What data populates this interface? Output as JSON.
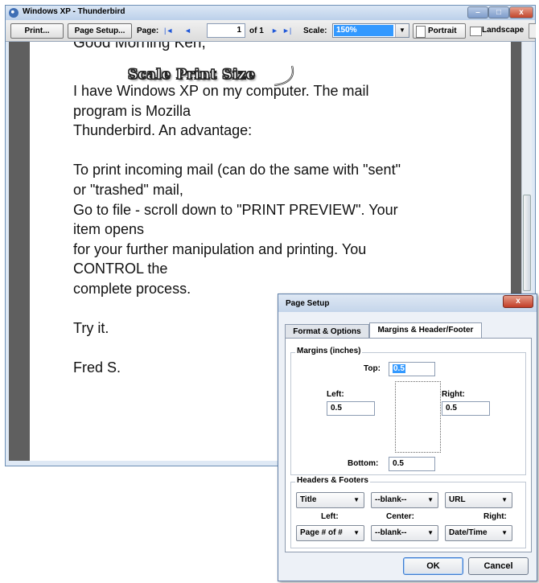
{
  "window": {
    "title": "Windows XP - Thunderbird",
    "controls": {
      "minimize": "–",
      "maximize": "□",
      "close": "x"
    }
  },
  "toolbar": {
    "print_label": "Print...",
    "page_setup_label": "Page Setup...",
    "page_label": "Page:",
    "first_page": "|◄",
    "prev_page": "◄",
    "page_value": "1",
    "of_text": "of 1",
    "next_page": "►",
    "last_page": "►|",
    "scale_label": "Scale:",
    "scale_value": "150%",
    "portrait_label": "Portrait",
    "landscape_label": "Landscape"
  },
  "annotation": "Scale Print Size",
  "document": {
    "cut_line": "Good Morning Ken,",
    "lines": [
      "I have Windows XP on my computer.  The mail",
      "program is Mozilla",
      "Thunderbird.  An advantage:",
      "",
      "To print incoming mail (can do the same with \"sent\"",
      "or \"trashed\" mail,",
      "Go to file - scroll down to \"PRINT PREVIEW\".  Your",
      "item opens",
      "for your further manipulation and printing.  You",
      "CONTROL the",
      "complete process.",
      "",
      "Try it.",
      "",
      "Fred S."
    ]
  },
  "dialog": {
    "title": "Page Setup",
    "close": "x",
    "tabs": {
      "format": "Format & Options",
      "margins": "Margins & Header/Footer"
    },
    "margins": {
      "group_title": "Margins (inches)",
      "top_label": "Top:",
      "top_value": "0.5",
      "left_label": "Left:",
      "left_value": "0.5",
      "right_label": "Right:",
      "right_value": "0.5",
      "bottom_label": "Bottom:",
      "bottom_value": "0.5"
    },
    "headers_footers": {
      "group_title": "Headers & Footers",
      "header_left": "Title",
      "header_center": "--blank--",
      "header_right": "URL",
      "left_label": "Left:",
      "center_label": "Center:",
      "right_label": "Right:",
      "footer_left": "Page # of #",
      "footer_center": "--blank--",
      "footer_right": "Date/Time"
    },
    "ok_label": "OK",
    "cancel_label": "Cancel"
  }
}
